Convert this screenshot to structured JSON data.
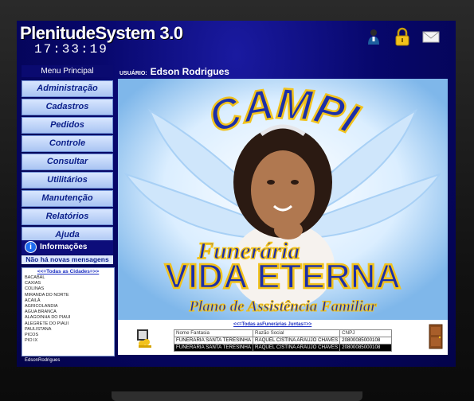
{
  "app": {
    "title": "PlenitudeSystem 3.0",
    "clock": "17:33:19",
    "footer_user": "EdsonRodrigues"
  },
  "top_icons": [
    "user-icon",
    "lock-icon",
    "mail-icon"
  ],
  "menu": {
    "header": "Menu Principal",
    "items": [
      "Administração",
      "Cadastros",
      "Pedidos",
      "Controle",
      "Consultar",
      "Utilitários",
      "Manutenção",
      "Relatórios",
      "Ajuda"
    ]
  },
  "info": {
    "label": "Informações",
    "no_messages": "Não há novas mensagens"
  },
  "cities": {
    "link": "<<=Todas as Cidades=>>",
    "items": [
      "BACABAL",
      "CAXIAS",
      "COLINAS",
      "MIRANDA DO NORTE",
      "ACAILÂ",
      "AGRICOLANDIA",
      "AGUA BRANCA",
      "ALAGOINHA DO PIAUI",
      "ALEGRETE DO PIAUI",
      "PAULISTANA",
      "PICOS",
      "PIO IX"
    ]
  },
  "user": {
    "label": "USUÁRIO:",
    "name": "Edson Rodrigues"
  },
  "banner": {
    "arc_text": "CAMPI",
    "funeraria": "Funerária",
    "brand": "VIDA ETERNA",
    "plan": "Plano de Assistência Familiar"
  },
  "funerarias": {
    "link": "<<=Todas asFunerárias Juntas=>>",
    "columns": [
      "Nome Fantasia",
      "Razão Social",
      "CNPJ"
    ],
    "rows": [
      [
        "FUNERARIA SANTA TERESINHA",
        "RAQUEL CISTINA ARAUJO CHAVES",
        "20800085000108"
      ],
      [
        "FUNERARIA SANTA TERESINHA",
        "RAQUEL CISTINA ARAUJO CHAVES",
        "20800085000108"
      ]
    ],
    "selected_row": 1
  },
  "colors": {
    "app_bg": "#07076b",
    "menu_item": "#a9c4f2",
    "menu_text": "#0b1f8a",
    "banner_blue": "#1c2fa8",
    "banner_yellow": "#f2c21b"
  }
}
